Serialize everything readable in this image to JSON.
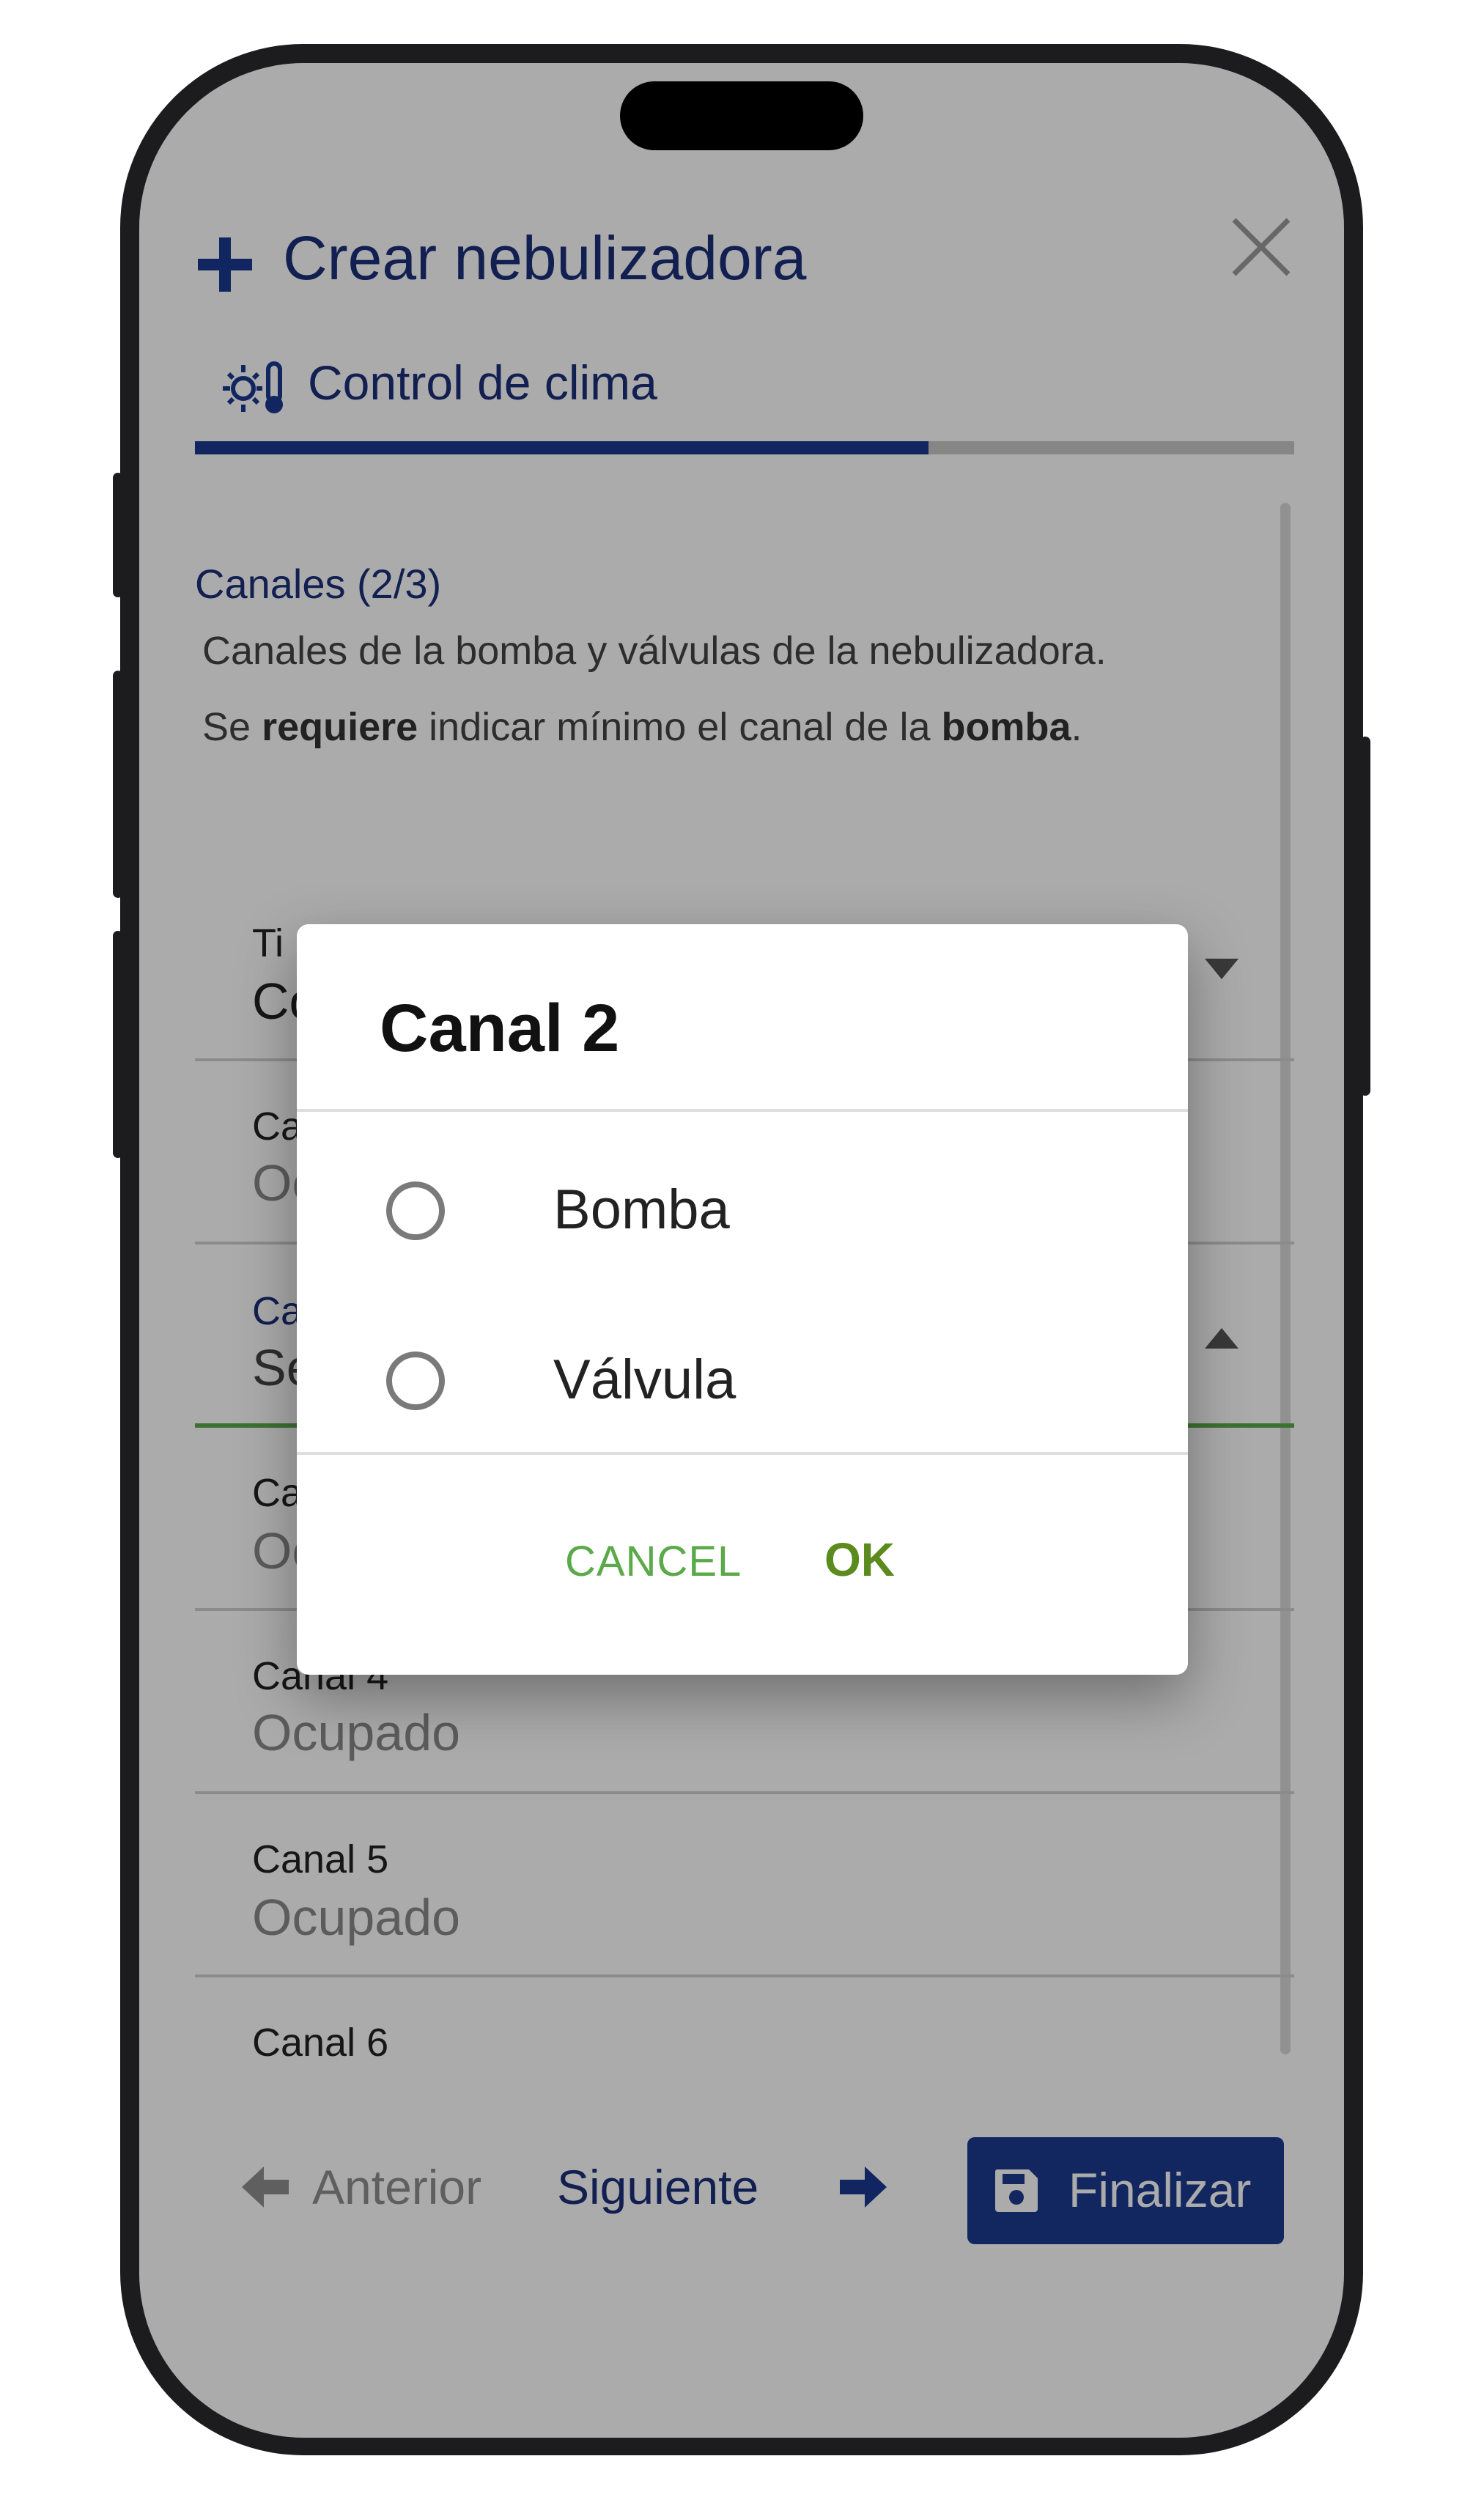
{
  "header": {
    "title": "Crear nebulizadora",
    "tab_label": "Control de clima",
    "progress": 0.667
  },
  "section": {
    "title": "Canales (2/3)",
    "description_line1": "Canales de la bomba y válvulas de la nebulizadora.",
    "desc2_part1": "Se ",
    "desc2_bold1": "requiere",
    "desc2_part2": " indicar mínimo el canal de la ",
    "desc2_bold2": "bomba",
    "desc2_part3": "."
  },
  "form_rows": [
    {
      "label": "Ti",
      "value": "Co"
    },
    {
      "label": "Ca",
      "value": "Oc"
    },
    {
      "label": "Ca",
      "value": "Se"
    },
    {
      "label": "Ca",
      "value": "Oc"
    },
    {
      "label": "Canal 4",
      "value": "Ocupado"
    },
    {
      "label": "Canal 5",
      "value": "Ocupado"
    },
    {
      "label": "Canal 6",
      "value": ""
    }
  ],
  "dialog": {
    "title": "Canal 2",
    "options": [
      "Bomba",
      "Válvula"
    ],
    "cancel_label": "CANCEL",
    "ok_label": "OK"
  },
  "footer": {
    "prev_label": "Anterior",
    "next_label": "Siguiente",
    "finish_label": "Finalizar"
  },
  "colors": {
    "primary": "#1b2f7a",
    "accent_green": "#5aaa4a",
    "progress_track": "#c8c8c8"
  }
}
